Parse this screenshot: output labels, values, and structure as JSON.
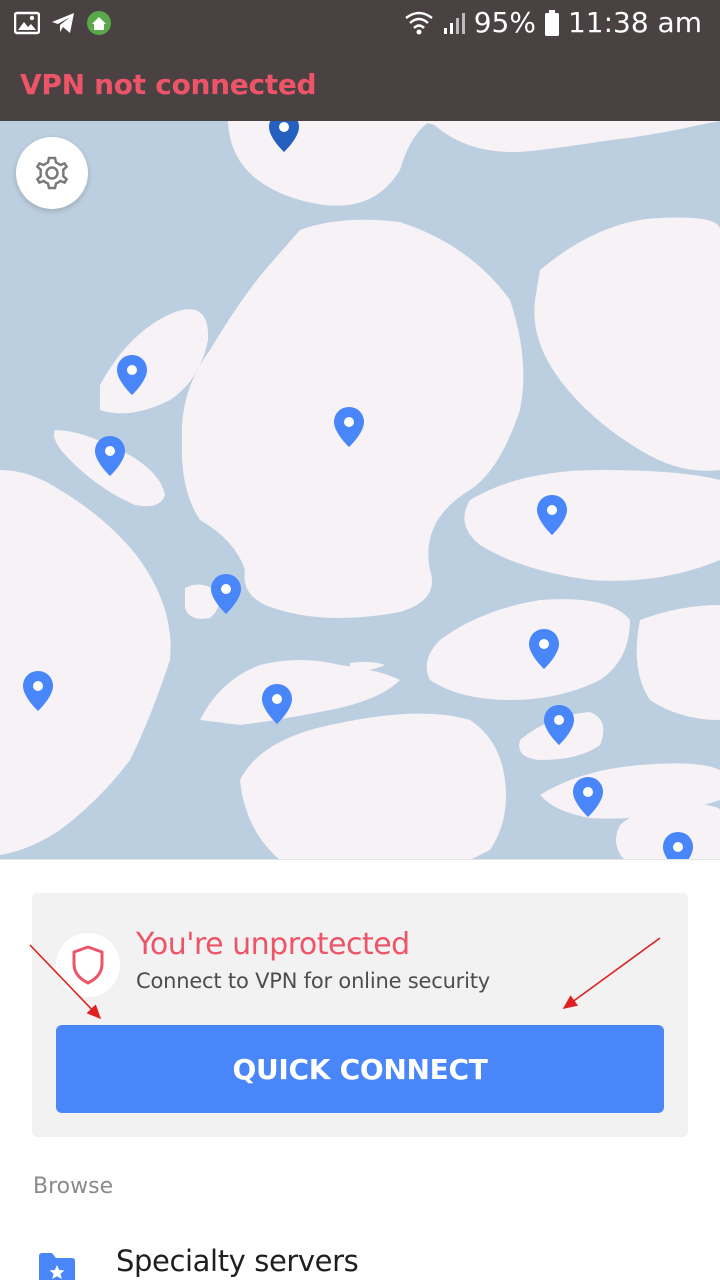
{
  "status_bar": {
    "battery": "95%",
    "time": "11:38 am",
    "icons": [
      "gallery-icon",
      "telegram-icon",
      "vpn-app-icon",
      "wifi-icon",
      "signal-icon",
      "battery-icon"
    ]
  },
  "header": {
    "vpn_status": "VPN not connected"
  },
  "colors": {
    "alert_red": "#ee5467",
    "primary_blue": "#4886fa",
    "map_water": "#bccfe0",
    "map_land": "#f6f2f6",
    "header_bg": "#4a4242"
  },
  "map": {
    "settings_icon": "gear-icon",
    "pin_icon": "location-pin-icon"
  },
  "protection_card": {
    "title": "You're unprotected",
    "subtitle": "Connect to VPN for online security",
    "icon": "shield-icon",
    "button_label": "QUICK CONNECT"
  },
  "browse": {
    "heading": "Browse",
    "items": [
      {
        "label": "Specialty servers",
        "icon": "specialty-folder-icon"
      }
    ]
  }
}
